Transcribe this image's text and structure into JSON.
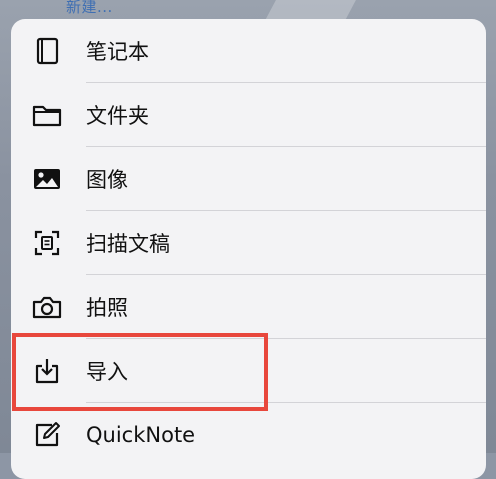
{
  "background": {
    "top_link": "新建..."
  },
  "menu": {
    "items": [
      {
        "label": "笔记本",
        "icon": "notebook-icon"
      },
      {
        "label": "文件夹",
        "icon": "folder-icon"
      },
      {
        "label": "图像",
        "icon": "image-icon"
      },
      {
        "label": "扫描文稿",
        "icon": "scan-document-icon"
      },
      {
        "label": "拍照",
        "icon": "camera-icon"
      },
      {
        "label": "导入",
        "icon": "import-icon"
      },
      {
        "label": "QuickNote",
        "icon": "quicknote-icon"
      }
    ]
  },
  "colors": {
    "highlight": "#e8473c",
    "menu_background": "#f3f3f5",
    "link": "#3f6fb3"
  }
}
